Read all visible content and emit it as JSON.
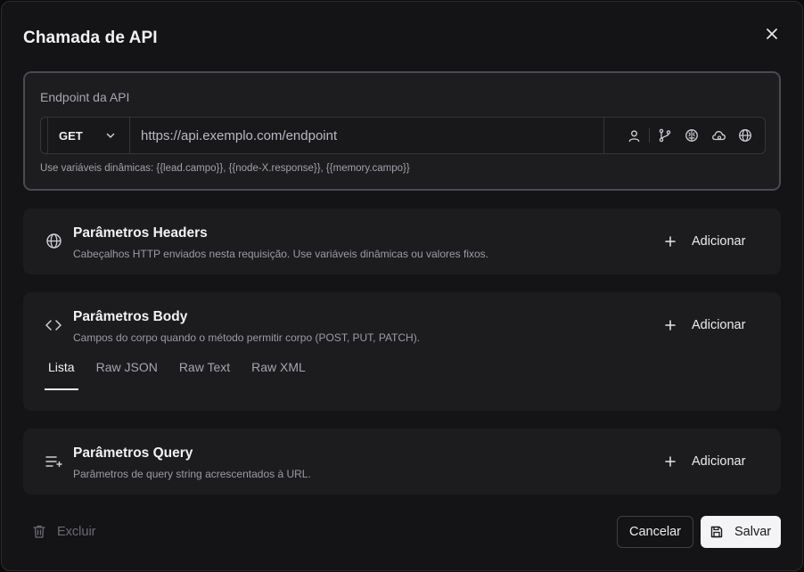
{
  "dialog": {
    "title": "Chamada de API",
    "close_icon": "x-close-icon"
  },
  "endpoint": {
    "label": "Endpoint da API",
    "method": "GET",
    "url": "https://api.exemplo.com/endpoint",
    "hint": "Use variáveis dinâmicas: {{lead.campo}}, {{node-X.response}}, {{memory.campo}}",
    "icons": [
      "user-icon",
      "git-branch-icon",
      "brain-icon",
      "cloud-icon",
      "globe-icon"
    ]
  },
  "headers": {
    "title": "Parâmetros Headers",
    "description": "Cabeçalhos HTTP enviados nesta requisição. Use variáveis dinâmicas ou valores fixos.",
    "add_label": "Adicionar"
  },
  "body": {
    "title": "Parâmetros Body",
    "description": "Campos do corpo quando o método permitir corpo (POST, PUT, PATCH).",
    "add_label": "Adicionar",
    "tabs": [
      "Lista",
      "Raw JSON",
      "Raw Text",
      "Raw XML"
    ],
    "active_tab": "Lista"
  },
  "query": {
    "title": "Parâmetros Query",
    "description": "Parâmetros de query string acrescentados à URL.",
    "add_label": "Adicionar"
  },
  "footer": {
    "delete_label": "Excluir",
    "cancel_label": "Cancelar",
    "save_label": "Salvar"
  },
  "colors": {
    "background": "#141416",
    "card": "#1c1c1f",
    "primary_button": "#f4f4f6",
    "muted_text": "#9b9ba2"
  }
}
